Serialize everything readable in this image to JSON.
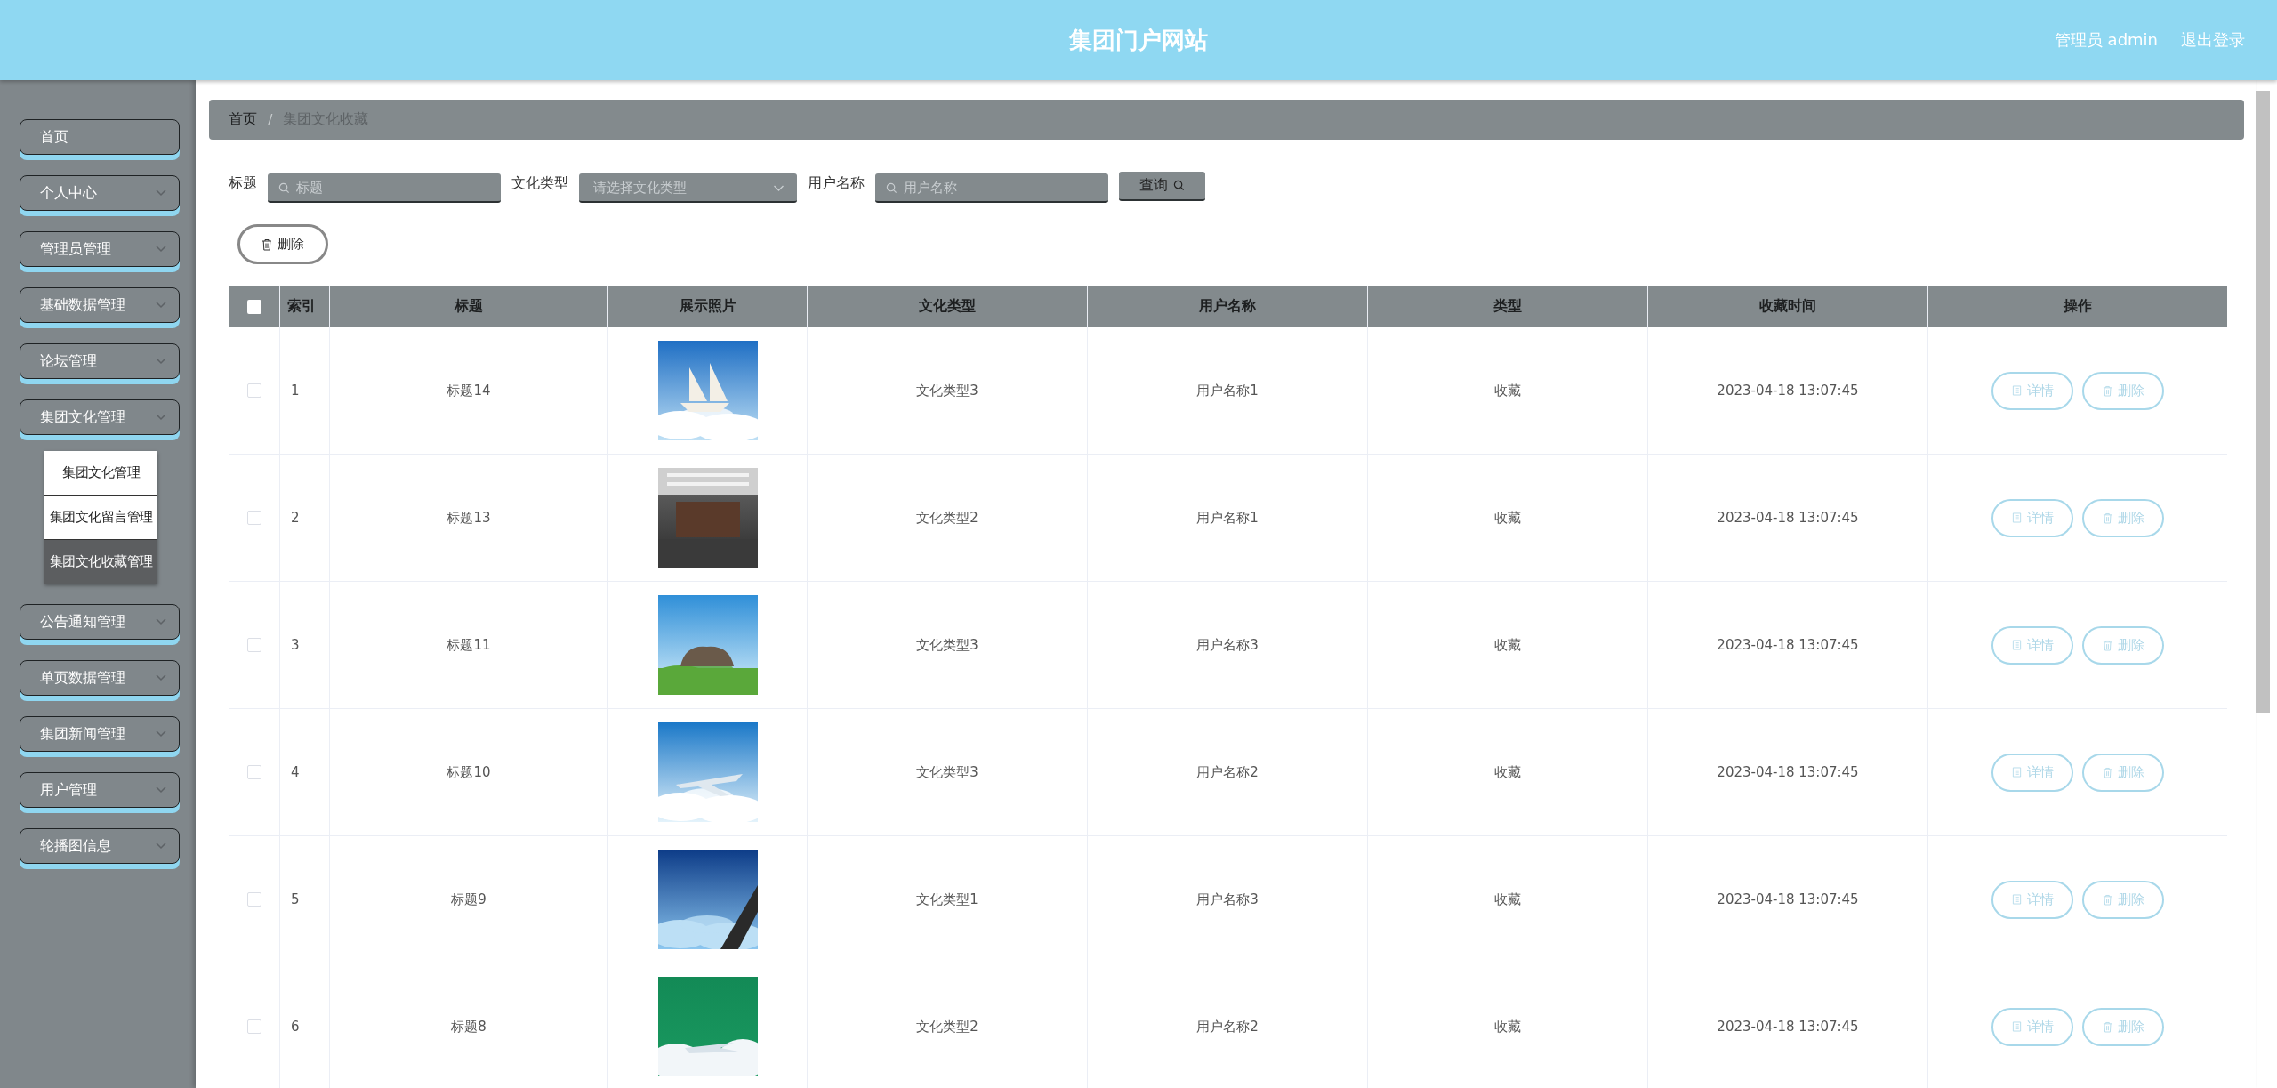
{
  "header": {
    "title": "集团门户网站",
    "user": "管理员 admin",
    "logout": "退出登录"
  },
  "sidebar": {
    "items": [
      {
        "label": "首页",
        "has_submenu": false
      },
      {
        "label": "个人中心",
        "has_submenu": true
      },
      {
        "label": "管理员管理",
        "has_submenu": true
      },
      {
        "label": "基础数据管理",
        "has_submenu": true
      },
      {
        "label": "论坛管理",
        "has_submenu": true
      },
      {
        "label": "集团文化管理",
        "has_submenu": true,
        "children": [
          {
            "label": "集团文化管理",
            "selected": false
          },
          {
            "label": "集团文化留言管理",
            "selected": false
          },
          {
            "label": "集团文化收藏管理",
            "selected": true
          }
        ]
      },
      {
        "label": "公告通知管理",
        "has_submenu": true
      },
      {
        "label": "单页数据管理",
        "has_submenu": true
      },
      {
        "label": "集团新闻管理",
        "has_submenu": true
      },
      {
        "label": "用户管理",
        "has_submenu": true
      },
      {
        "label": "轮播图信息",
        "has_submenu": true
      }
    ]
  },
  "breadcrumb": {
    "items": [
      "首页",
      "集团文化收藏"
    ],
    "separator": "/"
  },
  "search": {
    "fields": [
      {
        "label": "标题",
        "placeholder": "标题",
        "kind": "text"
      },
      {
        "label": "文化类型",
        "placeholder": "请选择文化类型",
        "kind": "select"
      },
      {
        "label": "用户名称",
        "placeholder": "用户名称",
        "kind": "text"
      }
    ],
    "button": "查询"
  },
  "toolbar": {
    "delete": "删除"
  },
  "table": {
    "all_checked": false,
    "columns": [
      "索引",
      "标题",
      "展示照片",
      "文化类型",
      "用户名称",
      "类型",
      "收藏时间",
      "操作"
    ],
    "rows": [
      {
        "checked": false,
        "index": "1",
        "title": "标题14",
        "culture_type": "文化类型3",
        "user": "用户名称1",
        "type": "收藏",
        "time": "2023-04-18 13:07:45",
        "actions": [
          "详情",
          "删除"
        ]
      },
      {
        "checked": false,
        "index": "2",
        "title": "标题13",
        "culture_type": "文化类型2",
        "user": "用户名称1",
        "type": "收藏",
        "time": "2023-04-18 13:07:45",
        "actions": [
          "详情",
          "删除"
        ]
      },
      {
        "checked": false,
        "index": "3",
        "title": "标题11",
        "culture_type": "文化类型3",
        "user": "用户名称3",
        "type": "收藏",
        "time": "2023-04-18 13:07:45",
        "actions": [
          "详情",
          "删除"
        ]
      },
      {
        "checked": false,
        "index": "4",
        "title": "标题10",
        "culture_type": "文化类型3",
        "user": "用户名称2",
        "type": "收藏",
        "time": "2023-04-18 13:07:45",
        "actions": [
          "详情",
          "删除"
        ]
      },
      {
        "checked": false,
        "index": "5",
        "title": "标题9",
        "culture_type": "文化类型1",
        "user": "用户名称3",
        "type": "收藏",
        "time": "2023-04-18 13:07:45",
        "actions": [
          "详情",
          "删除"
        ]
      },
      {
        "checked": false,
        "index": "6",
        "title": "标题8",
        "culture_type": "文化类型2",
        "user": "用户名称2",
        "type": "收藏",
        "time": "2023-04-18 13:07:45",
        "actions": [
          "详情",
          "删除"
        ]
      }
    ]
  }
}
